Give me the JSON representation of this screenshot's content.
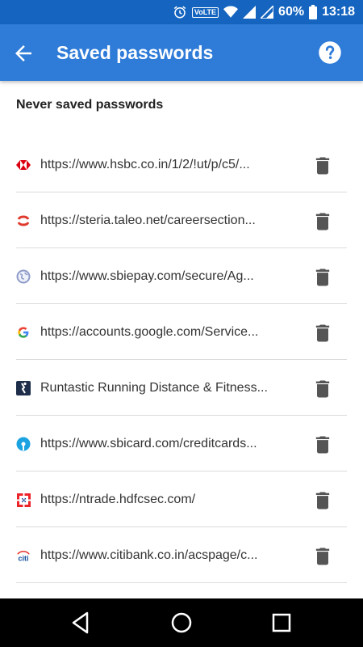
{
  "status": {
    "volte": "VoLTE",
    "battery": "60%",
    "time": "13:18"
  },
  "appbar": {
    "title": "Saved passwords",
    "back_icon": "arrow-back-icon",
    "help_icon": "help-icon"
  },
  "section": {
    "heading": "Never saved passwords"
  },
  "items": [
    {
      "text": "https://www.hsbc.co.in/1/2/!ut/p/c5/...",
      "icon": "hsbc-favicon"
    },
    {
      "text": "https://steria.taleo.net/careersection...",
      "icon": "taleo-favicon"
    },
    {
      "text": "https://www.sbiepay.com/secure/Ag...",
      "icon": "globe-favicon"
    },
    {
      "text": "https://accounts.google.com/Service...",
      "icon": "google-favicon"
    },
    {
      "text": "Runtastic Running Distance & Fitness...",
      "icon": "runtastic-favicon"
    },
    {
      "text": "https://www.sbicard.com/creditcards...",
      "icon": "sbi-favicon"
    },
    {
      "text": "https://ntrade.hdfcsec.com/",
      "icon": "hdfc-favicon"
    },
    {
      "text": "https://www.citibank.co.in/acspage/c...",
      "icon": "citi-favicon"
    }
  ],
  "citi_logo_text": "citi",
  "colors": {
    "status_bar": "#1565c0",
    "app_bar": "#2e7bd8",
    "delete_icon": "#555555"
  }
}
